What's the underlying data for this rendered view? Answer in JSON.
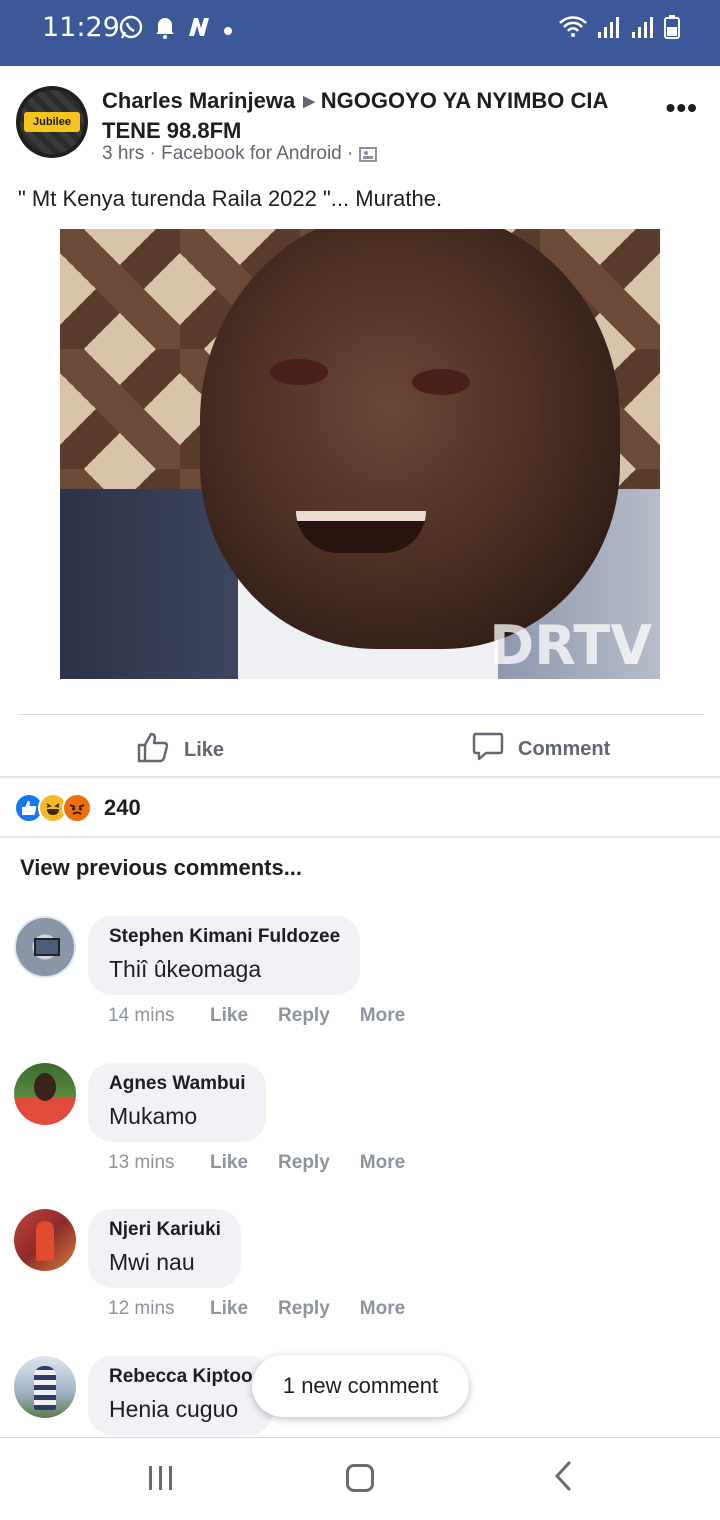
{
  "status_bar": {
    "time": "11:29",
    "background": "#3b5998",
    "left_icons": [
      "whatsapp-icon",
      "notification-bell-icon",
      "n-app-icon",
      "dot-icon"
    ],
    "right_icons": [
      "wifi-icon",
      "signal-icon",
      "signal-icon",
      "battery-icon"
    ]
  },
  "post": {
    "author": "Charles Marinjewa",
    "group": "NGOGOYO YA NYIMBO CIA TENE 98.8FM",
    "meta": "3 hrs · Facebook for Android ·",
    "avatar_label": "Jubilee",
    "text": "\" Mt Kenya turenda Raila 2022 \"... Murathe.",
    "photo_watermark": "DRTV",
    "actions": {
      "like": "Like",
      "comment": "Comment"
    },
    "reactions": {
      "icons": [
        "like-reaction-icon",
        "haha-reaction-icon",
        "angry-reaction-icon"
      ],
      "count": "240"
    }
  },
  "comments_section": {
    "view_previous": "View previous comments...",
    "comments": [
      {
        "name": "Stephen Kimani Fuldozee",
        "text": "Thiî ûkeomaga",
        "time": "14 mins",
        "like": "Like",
        "reply": "Reply",
        "more": "More"
      },
      {
        "name": "Agnes Wambui",
        "text": "Mukamo",
        "time": "13 mins",
        "like": "Like",
        "reply": "Reply",
        "more": "More"
      },
      {
        "name": "Njeri Kariuki",
        "text": "Mwi nau",
        "time": "12 mins",
        "like": "Like",
        "reply": "Reply",
        "more": "More"
      },
      {
        "name": "Rebecca Kiptoo",
        "text": "Henia cuguo"
      }
    ],
    "new_comment_pill": "1 new comment"
  },
  "nav_bar": {
    "buttons": [
      "recent-apps",
      "home",
      "back"
    ]
  },
  "colors": {
    "accent": "#3b5998",
    "like_blue": "#1877f2",
    "secondary_text": "#606770",
    "bubble": "#f0f2f5"
  }
}
